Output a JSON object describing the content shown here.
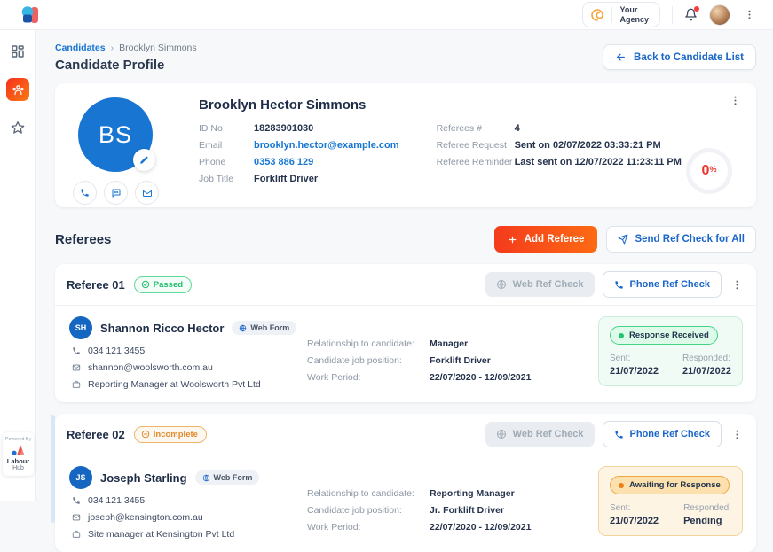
{
  "colors": {
    "accent_blue": "#1876d2",
    "link_blue": "#1b66c9",
    "brand_gradient_start": "#f43b1c",
    "brand_gradient_end": "#fd6a13",
    "success_green": "#22c373",
    "warning_orange": "#e8913a",
    "progress_red": "#e8352c"
  },
  "icons": {
    "notification": "bell-icon",
    "more_menu": "kebab-icon",
    "edit": "pencil-icon",
    "call": "phone-icon",
    "sms": "chat-icon",
    "email": "mail-icon",
    "web": "globe-icon",
    "company": "briefcase-icon",
    "send": "paper-plane-icon",
    "back": "arrow-left-icon",
    "add": "plus-icon",
    "passed": "check-circle-icon",
    "incomplete": "minus-circle-icon"
  },
  "topbar": {
    "agency": {
      "line1": "Your",
      "line2": "Agency"
    }
  },
  "sidebar": {
    "items": [
      {
        "name": "dashboard",
        "active": false
      },
      {
        "name": "candidates",
        "active": true
      },
      {
        "name": "favorites",
        "active": false
      }
    ],
    "powered_by": {
      "label": "Powered By",
      "brand_top": "Labour",
      "brand_bottom": "Hub"
    }
  },
  "breadcrumb": {
    "parent": "Candidates",
    "separator": "›",
    "current": "Brooklyn Simmons"
  },
  "page": {
    "title": "Candidate Profile",
    "back_button_label": "Back to Candidate List"
  },
  "profile": {
    "initials": "BS",
    "name": "Brooklyn Hector Simmons",
    "fields_left": [
      {
        "label": "ID No",
        "value": "18283901030"
      },
      {
        "label": "Email",
        "value": "brooklyn.hector@example.com"
      },
      {
        "label": "Phone",
        "value": "0353 886 129"
      },
      {
        "label": "Job Title",
        "value": "Forklift Driver"
      }
    ],
    "fields_right": [
      {
        "label": "Referees #",
        "value": "4"
      },
      {
        "label": "Referee Request",
        "value": "Sent on 02/07/2022 03:33:21 PM"
      },
      {
        "label": "Referee Reminder",
        "value": "Last sent on 12/07/2022 11:23:11 PM"
      }
    ],
    "progress": {
      "value": "0",
      "unit": "%"
    }
  },
  "referees_section": {
    "title": "Referees",
    "add_button_label": "Add Referee",
    "send_all_button_label": "Send Ref Check for All"
  },
  "referees": [
    {
      "title": "Referee 01",
      "status_label": "Passed",
      "initials": "SH",
      "name": "Shannon Ricco Hector",
      "form_badge": "Web Form",
      "phone": "034 121 3455",
      "email": "shannon@woolsworth.com.au",
      "company_role": "Reporting Manager at Woolsworth Pvt Ltd",
      "relationship_label": "Relationship to candidate:",
      "relationship_value": "Manager",
      "job_position_label": "Candidate job position:",
      "job_position_value": "Forklift Driver",
      "work_period_label": "Work Period:",
      "work_period_value": "22/07/2020 - 12/09/2021",
      "web_check_button": "Web Ref Check",
      "phone_check_button": "Phone Ref Check",
      "response_status": "Response Received",
      "sent_label": "Sent:",
      "sent_value": "21/07/2022",
      "responded_label": "Responded:",
      "responded_value": "21/07/2022"
    },
    {
      "title": "Referee 02",
      "status_label": "Incomplete",
      "initials": "JS",
      "name": "Joseph Starling",
      "form_badge": "Web Form",
      "phone": "034 121 3455",
      "email": "joseph@kensington.com.au",
      "company_role": "Site manager at Kensington Pvt Ltd",
      "relationship_label": "Relationship to candidate:",
      "relationship_value": "Reporting Manager",
      "job_position_label": "Candidate job position:",
      "job_position_value": "Jr. Forklift Driver",
      "work_period_label": "Work Period:",
      "work_period_value": "22/07/2020 - 12/09/2021",
      "web_check_button": "Web Ref Check",
      "phone_check_button": "Phone Ref Check",
      "response_status": "Awaiting for Response",
      "sent_label": "Sent:",
      "sent_value": "21/07/2022",
      "responded_label": "Responded:",
      "responded_value": "Pending"
    }
  ]
}
